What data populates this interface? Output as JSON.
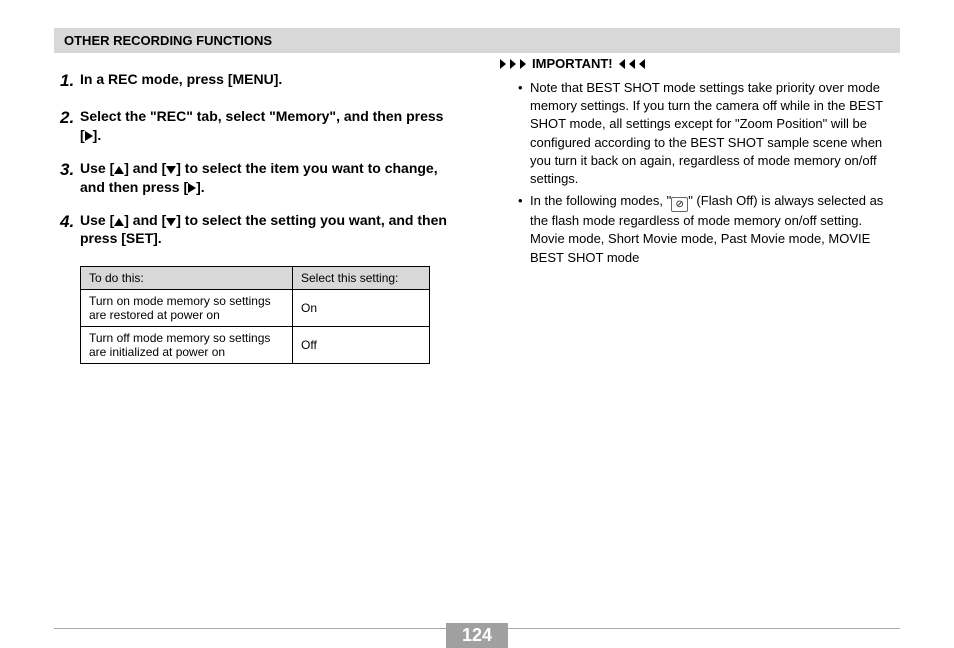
{
  "header": {
    "title": "OTHER RECORDING FUNCTIONS"
  },
  "steps": [
    {
      "num": "1.",
      "text_a": "In a REC mode, press [MENU]."
    },
    {
      "num": "2.",
      "text_a": "Select the \"REC\" tab, select \"Memory\", and then press [",
      "text_b": "]."
    },
    {
      "num": "3.",
      "text_a": "Use [",
      "text_b": "] and [",
      "text_c": "] to select the item you want to change, and then press [",
      "text_d": "]."
    },
    {
      "num": "4.",
      "text_a": "Use [",
      "text_b": "] and [",
      "text_c": "] to select the setting you want, and then press [SET]."
    }
  ],
  "table": {
    "headers": [
      "To do this:",
      "Select this setting:"
    ],
    "rows": [
      [
        "Turn on mode memory so settings are restored at power on",
        "On"
      ],
      [
        "Turn off mode memory so settings are initialized at power on",
        "Off"
      ]
    ]
  },
  "important": {
    "label": "IMPORTANT!",
    "notes": [
      {
        "before": "Note that BEST SHOT mode settings take priority over mode memory settings. If you turn the camera off while in the BEST SHOT mode, all settings except for \"Zoom Position\" will be configured according to the BEST SHOT sample scene when you turn it back on again, regardless of mode memory on/off settings."
      },
      {
        "before": "In the following modes, \"",
        "icon": true,
        "after": "\" (Flash Off) is always selected as the flash mode regardless of mode memory on/off setting.",
        "extra": "Movie mode, Short Movie mode, Past Movie mode, MOVIE BEST SHOT mode"
      }
    ]
  },
  "page_number": "124"
}
